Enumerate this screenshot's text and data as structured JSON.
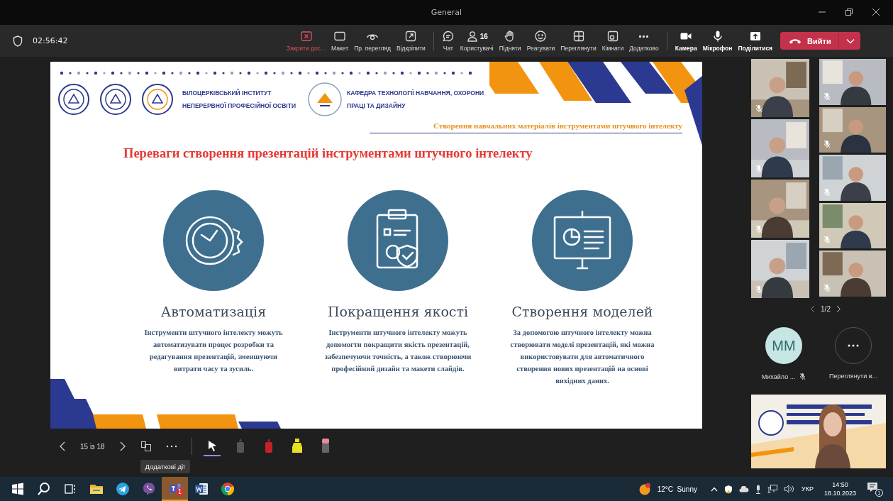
{
  "window": {
    "title": "General"
  },
  "call_bar": {
    "timer": "02:56:42",
    "actions": [
      {
        "kind": "stop",
        "label": "Закрити дос..."
      },
      {
        "kind": "layout",
        "label": "Макет"
      },
      {
        "kind": "preview",
        "label": "Пр. перегляд"
      },
      {
        "kind": "popout",
        "label": "Відкріпити"
      },
      {
        "kind": "separator"
      },
      {
        "kind": "chat",
        "label": "Чат"
      },
      {
        "kind": "people",
        "label": "Користувачі",
        "count": "16"
      },
      {
        "kind": "raise",
        "label": "Підняти"
      },
      {
        "kind": "react",
        "label": "Реагувати"
      },
      {
        "kind": "view",
        "label": "Переглянути"
      },
      {
        "kind": "rooms",
        "label": "Кімнати"
      },
      {
        "kind": "more",
        "label": "Додатково"
      },
      {
        "kind": "separator"
      },
      {
        "kind": "camera",
        "label": "Камера"
      },
      {
        "kind": "mic",
        "label": "Мікрофон"
      },
      {
        "kind": "share",
        "label": "Поділитися"
      }
    ],
    "leave_button": "Вийти"
  },
  "slide": {
    "institute": [
      "БІЛОЦЕРКІВСЬКИЙ ІНСТИТУТ",
      "НЕПЕРЕРВНОЇ ПРОФЕСІЙНОЇ ОСВІТИ"
    ],
    "department": [
      "КАФЕДРА ТЕХНОЛОГІЇ НАВЧАННЯ, ОХОРОНИ",
      "ПРАЦІ ТА ДИЗАЙНУ"
    ],
    "subtitle": "Створення навчальних матеріалів інструментами штучного інтелекту",
    "title": "Переваги створення презентацій інструментами штучного інтелекту",
    "features": [
      {
        "kind": "clock",
        "title": "Автоматизація",
        "text": "Інструменти штучного інтелекту можуть автоматизувати процес розробки та редагування презентацій, зменшуючи витрати часу та зусиль."
      },
      {
        "kind": "clipboard",
        "title": "Покращення якості",
        "text": "Інструменти штучного інтелекту можуть допомогти покращити якість презентацій, забезпечуючи точність, а також створюючи професійний дизайн та макети слайдів."
      },
      {
        "kind": "board",
        "title": "Створення моделей",
        "text": "За допомогою штучного інтелекту можна створювати моделі презентацій, які можна використовувати для автоматичного створення нових презентацій на основі вихідних даних."
      }
    ]
  },
  "slide_controls": {
    "counter": "15 із 18",
    "tooltip": "Додаткові дії",
    "tools": [
      {
        "kind": "pointer",
        "selected": true
      },
      {
        "kind": "pen",
        "color": "#555555",
        "selected": false
      },
      {
        "kind": "pen",
        "color": "#c4202a",
        "selected": false
      },
      {
        "kind": "highlighter",
        "color": "#e8e020",
        "selected": false
      },
      {
        "kind": "eraser",
        "color": "#e88a9a",
        "selected": false
      }
    ]
  },
  "video_grid": {
    "left": [
      {
        "muted": true
      },
      {
        "muted": true
      },
      {
        "muted": true
      },
      {
        "muted": true
      }
    ],
    "right": [
      {
        "muted": true
      },
      {
        "muted": true
      },
      {
        "muted": true
      },
      {
        "muted": true
      },
      {
        "muted": true
      }
    ],
    "pager": "1/2"
  },
  "roster": [
    {
      "kind": "avatar",
      "initials": "MM",
      "name": "Михайло ...",
      "muted": true
    },
    {
      "kind": "more",
      "name": "Переглянути в..."
    }
  ],
  "taskbar": {
    "apps": [
      {
        "kind": "start",
        "selected": false
      },
      {
        "kind": "search",
        "selected": false
      },
      {
        "kind": "taskview",
        "selected": false
      },
      {
        "kind": "explorer",
        "selected": false
      },
      {
        "kind": "telegram",
        "selected": false
      },
      {
        "kind": "viber",
        "selected": false
      },
      {
        "kind": "teams",
        "selected": true,
        "badge": "1"
      },
      {
        "kind": "word",
        "selected": false
      },
      {
        "kind": "chrome",
        "selected": false
      }
    ],
    "weather": "12°C  Sunny",
    "language": "УКР",
    "time": "14:50",
    "date": "18.10.2023",
    "notifications": "1"
  }
}
